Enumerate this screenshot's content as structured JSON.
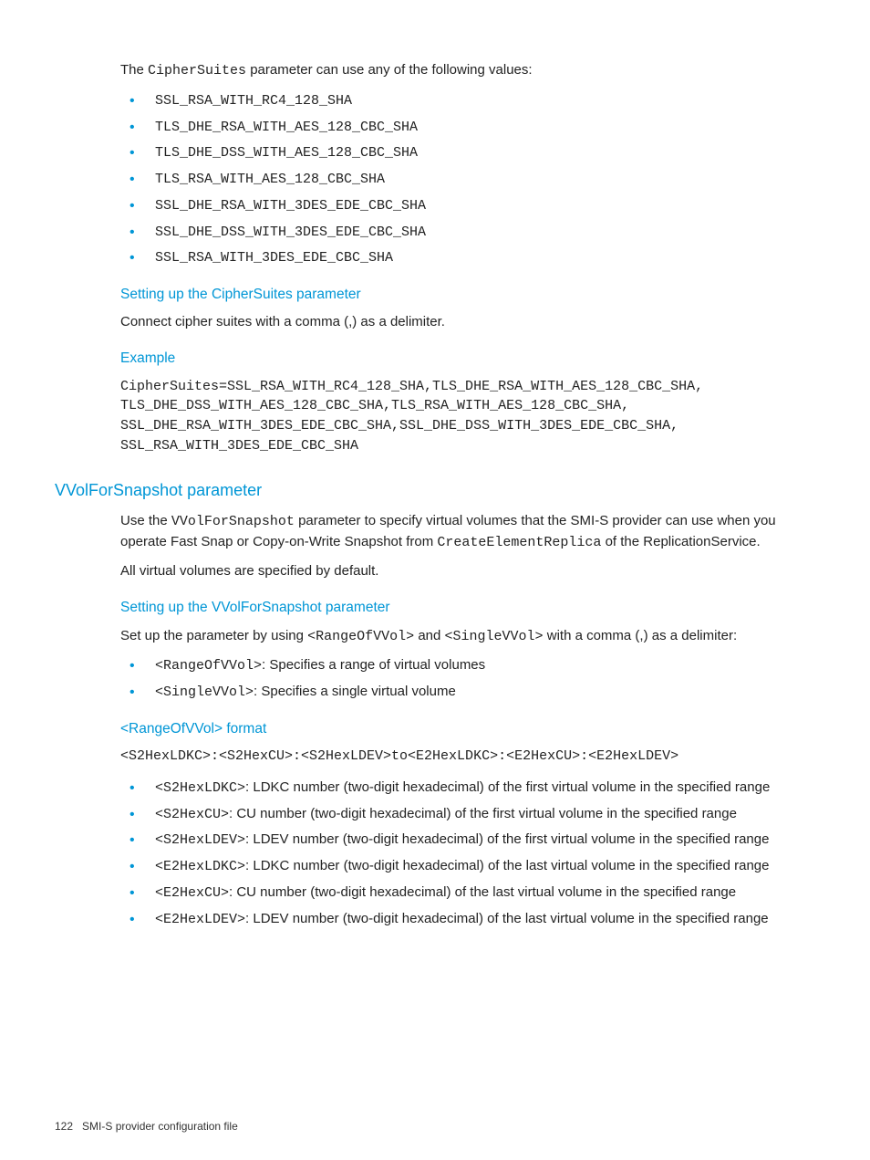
{
  "intro": {
    "prefix": "The ",
    "code": "CipherSuites",
    "suffix": " parameter can use any of the following values:"
  },
  "cipher_list": [
    "SSL_RSA_WITH_RC4_128_SHA",
    "TLS_DHE_RSA_WITH_AES_128_CBC_SHA",
    "TLS_DHE_DSS_WITH_AES_128_CBC_SHA",
    "TLS_RSA_WITH_AES_128_CBC_SHA",
    "SSL_DHE_RSA_WITH_3DES_EDE_CBC_SHA",
    "SSL_DHE_DSS_WITH_3DES_EDE_CBC_SHA",
    "SSL_RSA_WITH_3DES_EDE_CBC_SHA"
  ],
  "cs_setup": {
    "heading": "Setting up the CipherSuites parameter",
    "body": "Connect cipher suites with a comma (,) as a delimiter."
  },
  "cs_example": {
    "heading": "Example",
    "body": "CipherSuites=SSL_RSA_WITH_RC4_128_SHA,TLS_DHE_RSA_WITH_AES_128_CBC_SHA,\nTLS_DHE_DSS_WITH_AES_128_CBC_SHA,TLS_RSA_WITH_AES_128_CBC_SHA,\nSSL_DHE_RSA_WITH_3DES_EDE_CBC_SHA,SSL_DHE_DSS_WITH_3DES_EDE_CBC_SHA,\nSSL_RSA_WITH_3DES_EDE_CBC_SHA"
  },
  "vvol": {
    "heading": "VVolForSnapshot parameter",
    "p1_pre": "Use the ",
    "p1_c1": "VVolForSnapshot",
    "p1_mid": " parameter to specify virtual volumes that the SMI-S provider can use when you operate Fast Snap or Copy-on-Write Snapshot from ",
    "p1_c2": "CreateElementReplica",
    "p1_post": " of the ReplicationService.",
    "p2": "All virtual volumes are specified by default."
  },
  "vvol_setup": {
    "heading": "Setting up the VVolForSnapshot parameter",
    "p_pre": "Set up the parameter by using ",
    "p_c1": "<RangeOfVVol>",
    "p_mid": " and ",
    "p_c2": "<SingleVVol>",
    "p_post": " with a comma (,) as a delimiter:",
    "items": [
      {
        "code": "<RangeOfVVol>",
        "text": ": Specifies a range of virtual volumes"
      },
      {
        "code": "<SingleVVol>",
        "text": ": Specifies a single virtual volume"
      }
    ]
  },
  "range_format": {
    "heading": "<RangeOfVVol> format",
    "syntax": "<S2HexLDKC>:<S2HexCU>:<S2HexLDEV>to<E2HexLDKC>:<E2HexCU>:<E2HexLDEV>",
    "items": [
      {
        "code": "<S2HexLDKC>",
        "text": ": LDKC number (two-digit hexadecimal) of the first virtual volume in the specified range"
      },
      {
        "code": "<S2HexCU>",
        "text": ": CU number (two-digit hexadecimal) of the first virtual volume in the specified range"
      },
      {
        "code": "<S2HexLDEV>",
        "text": ": LDEV number (two-digit hexadecimal) of the first virtual volume in the specified range"
      },
      {
        "code": "<E2HexLDKC>",
        "text": ": LDKC number (two-digit hexadecimal) of the last virtual volume in the specified range"
      },
      {
        "code": "<E2HexCU>",
        "text": ": CU number (two-digit hexadecimal) of the last virtual volume in the specified range"
      },
      {
        "code": "<E2HexLDEV>",
        "text": ": LDEV number (two-digit hexadecimal) of the last virtual volume in the specified range"
      }
    ]
  },
  "footer": {
    "page": "122",
    "title": "SMI-S provider configuration file"
  }
}
